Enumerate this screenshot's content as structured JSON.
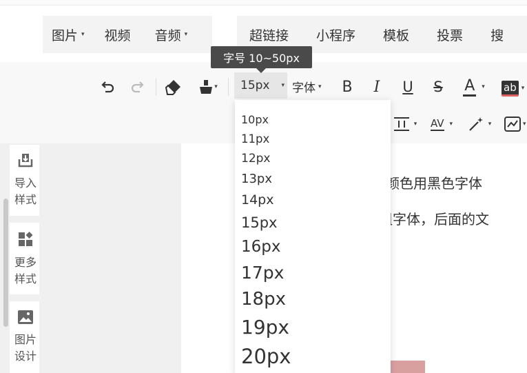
{
  "insert_bar": {
    "group1": [
      {
        "label": "图片",
        "caret": "▾"
      },
      {
        "label": "视频",
        "caret": ""
      },
      {
        "label": "音频",
        "caret": "▾"
      }
    ],
    "group2": [
      {
        "label": "超链接"
      },
      {
        "label": "小程序"
      },
      {
        "label": "模板"
      },
      {
        "label": "投票"
      },
      {
        "label": "搜"
      }
    ]
  },
  "toolbar": {
    "font_size_value": "15px",
    "font_size_caret": "▾",
    "font_family_label": "字体",
    "font_family_caret": "▾",
    "bold_glyph": "B",
    "italic_glyph": "I",
    "underline_glyph": "U",
    "strike_glyph": "S",
    "font_color_glyph": "A",
    "highlight_glyph": "ab",
    "letter_spacing_glyph": "AV",
    "caret": "▾"
  },
  "tooltip": {
    "text": "字号 10~50px"
  },
  "font_size_options": [
    "10px",
    "11px",
    "12px",
    "13px",
    "14px",
    "15px",
    "16px",
    "17px",
    "18px",
    "19px",
    "20px"
  ],
  "side_panel": {
    "items": [
      {
        "line1": "导入",
        "line2": "样式",
        "icon": "import-icon"
      },
      {
        "line1": "更多",
        "line2": "样式",
        "icon": "grid-icon"
      },
      {
        "line1": "图片",
        "line2": "设计",
        "icon": "image-icon"
      }
    ]
  },
  "content": {
    "line1": "主题颜色用黑色字体",
    "line2": "加粗字体，后面的文"
  },
  "colors": {
    "toolbar_bg": "#f8f8f8",
    "tooltip_bg": "#4a4a4a",
    "selected_bg": "#e6e6e6",
    "font_color_underline": "#333333",
    "highlight_underline": "#e06060"
  }
}
